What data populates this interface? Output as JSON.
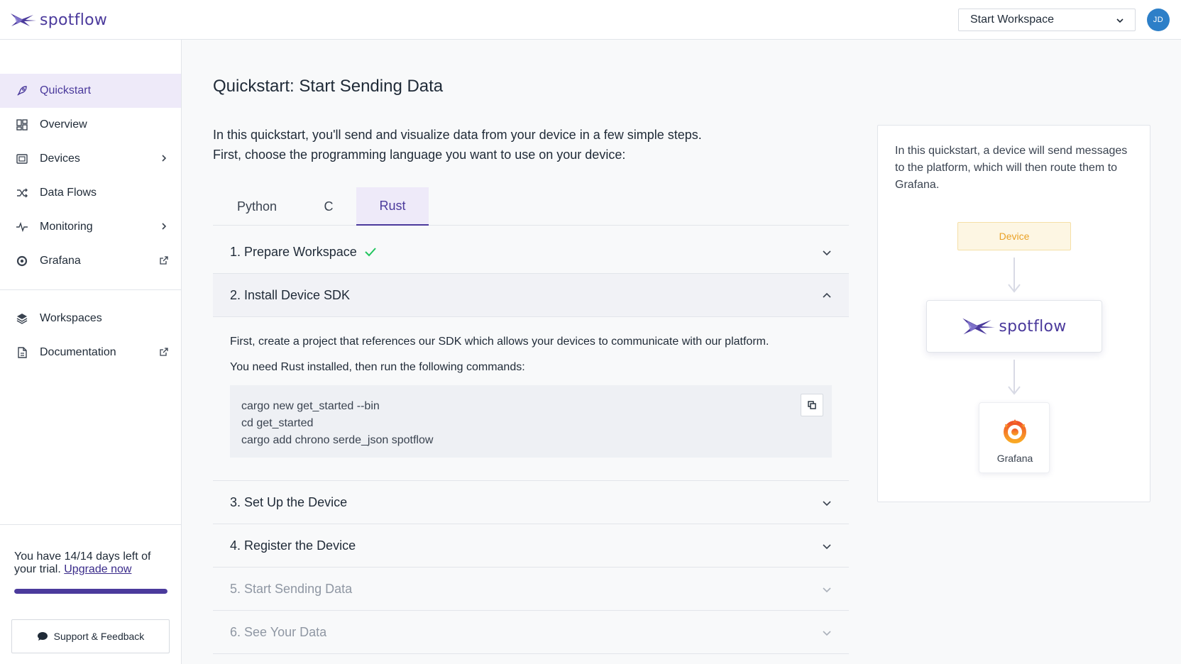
{
  "header": {
    "logo_text": "spotflow",
    "workspace_select": "Start Workspace",
    "avatar_initials": "JD"
  },
  "sidebar": {
    "items": [
      {
        "label": "Quickstart",
        "icon": "rocket-icon",
        "active": true
      },
      {
        "label": "Overview",
        "icon": "dashboard-icon"
      },
      {
        "label": "Devices",
        "icon": "device-icon",
        "submenu": true
      },
      {
        "label": "Data Flows",
        "icon": "shuffle-icon"
      },
      {
        "label": "Monitoring",
        "icon": "pulse-icon",
        "submenu": true
      },
      {
        "label": "Grafana",
        "icon": "grafana-icon",
        "external": true
      }
    ],
    "secondary_items": [
      {
        "label": "Workspaces",
        "icon": "layers-icon"
      },
      {
        "label": "Documentation",
        "icon": "document-icon",
        "external": true
      }
    ],
    "trial": {
      "text": "You have 14/14 days left of your trial.",
      "link_text": "Upgrade now",
      "progress": 1.0
    },
    "support_label": "Support & Feedback"
  },
  "main": {
    "title": "Quickstart: Start Sending Data",
    "intro_line1": "In this quickstart, you'll send and visualize data from your device in a few simple steps.",
    "intro_line2": "First, choose the programming language you want to use on your device:",
    "tabs": [
      {
        "label": "Python"
      },
      {
        "label": "C"
      },
      {
        "label": "Rust",
        "active": true
      }
    ],
    "steps": [
      {
        "label": "1. Prepare Workspace",
        "completed": true
      },
      {
        "label": "2. Install Device SDK",
        "open": true
      },
      {
        "label": "3. Set Up the Device"
      },
      {
        "label": "4. Register the Device"
      },
      {
        "label": "5. Start Sending Data",
        "disabled": true
      },
      {
        "label": "6. See Your Data",
        "disabled": true
      }
    ],
    "step2": {
      "paragraph1": "First, create a project that references our SDK which allows your devices to communicate with our platform.",
      "paragraph2": "You need Rust installed, then run the following commands:",
      "code_lines": [
        "cargo new get_started --bin",
        "cd get_started",
        "cargo add chrono serde_json spotflow"
      ]
    }
  },
  "right_panel": {
    "description": "In this quickstart, a device will send messages to the platform, which will then route them to Grafana.",
    "device_label": "Device",
    "platform_logo_text": "spotflow",
    "grafana_label": "Grafana"
  },
  "colors": {
    "accent": "#4b3a9c",
    "active_bg": "#eeeaf9",
    "success": "#22c55e",
    "device_text": "#e9a126"
  }
}
